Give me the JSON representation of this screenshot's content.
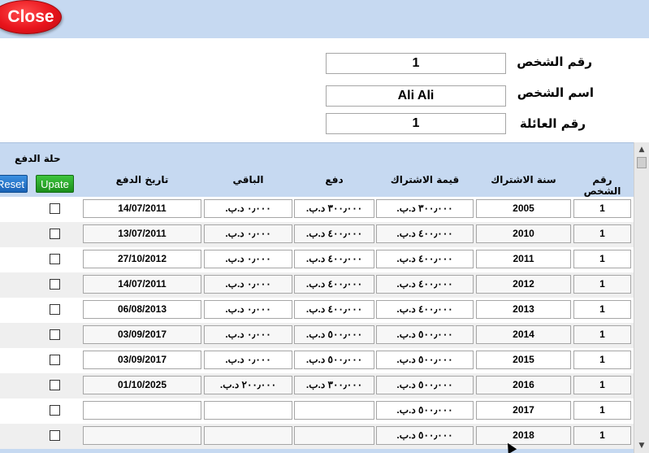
{
  "top": {
    "close_label": "Close"
  },
  "form": {
    "person_no_label": "رقم الشخص",
    "person_no_value": "1",
    "person_name_label": "اسم الشخص",
    "person_name_value": "Ali Ali",
    "family_no_label": "رقم العائلة",
    "family_no_value": "1"
  },
  "grid": {
    "payment_status_label": "حلة الدفع",
    "reset_label": "Reset",
    "upate_label": "Upate",
    "columns": {
      "person_no": "رقم الشخص",
      "sub_year": "سنة الاشتراك",
      "sub_value": "قيمة الاشتراك",
      "paid": "دفع",
      "remaining": "الباقي",
      "pay_date": "تاريخ الدفع"
    },
    "rows": [
      {
        "person_no": "1",
        "year": "2005",
        "sub_value": "٣٠٠٫٠٠٠ د.ب.",
        "paid": "٣٠٠٫٠٠٠ د.ب.",
        "remaining": "٠٫٠٠٠ د.ب.",
        "date": "14/07/2011"
      },
      {
        "person_no": "1",
        "year": "2010",
        "sub_value": "٤٠٠٫٠٠٠ د.ب.",
        "paid": "٤٠٠٫٠٠٠ د.ب.",
        "remaining": "٠٫٠٠٠ د.ب.",
        "date": "13/07/2011"
      },
      {
        "person_no": "1",
        "year": "2011",
        "sub_value": "٤٠٠٫٠٠٠ د.ب.",
        "paid": "٤٠٠٫٠٠٠ د.ب.",
        "remaining": "٠٫٠٠٠ د.ب.",
        "date": "27/10/2012"
      },
      {
        "person_no": "1",
        "year": "2012",
        "sub_value": "٤٠٠٫٠٠٠ د.ب.",
        "paid": "٤٠٠٫٠٠٠ د.ب.",
        "remaining": "٠٫٠٠٠ د.ب.",
        "date": "14/07/2011"
      },
      {
        "person_no": "1",
        "year": "2013",
        "sub_value": "٤٠٠٫٠٠٠ د.ب.",
        "paid": "٤٠٠٫٠٠٠ د.ب.",
        "remaining": "٠٫٠٠٠ د.ب.",
        "date": "06/08/2013"
      },
      {
        "person_no": "1",
        "year": "2014",
        "sub_value": "٥٠٠٫٠٠٠ د.ب.",
        "paid": "٥٠٠٫٠٠٠ د.ب.",
        "remaining": "٠٫٠٠٠ د.ب.",
        "date": "03/09/2017"
      },
      {
        "person_no": "1",
        "year": "2015",
        "sub_value": "٥٠٠٫٠٠٠ د.ب.",
        "paid": "٥٠٠٫٠٠٠ د.ب.",
        "remaining": "٠٫٠٠٠ د.ب.",
        "date": "03/09/2017"
      },
      {
        "person_no": "1",
        "year": "2016",
        "sub_value": "٥٠٠٫٠٠٠ د.ب.",
        "paid": "٣٠٠٫٠٠٠ د.ب.",
        "remaining": "٢٠٠٫٠٠٠ د.ب.",
        "date": "01/10/2025"
      },
      {
        "person_no": "1",
        "year": "2017",
        "sub_value": "٥٠٠٫٠٠٠ د.ب.",
        "paid": "",
        "remaining": "",
        "date": ""
      },
      {
        "person_no": "1",
        "year": "2018",
        "sub_value": "٥٠٠٫٠٠٠ د.ب.",
        "paid": "",
        "remaining": "",
        "date": ""
      }
    ]
  },
  "colors": {
    "header_bg": "#c6d9f1",
    "close_red": "#e8141c",
    "reset_blue": "#1a62b6",
    "upate_green": "#1b8f1b"
  }
}
